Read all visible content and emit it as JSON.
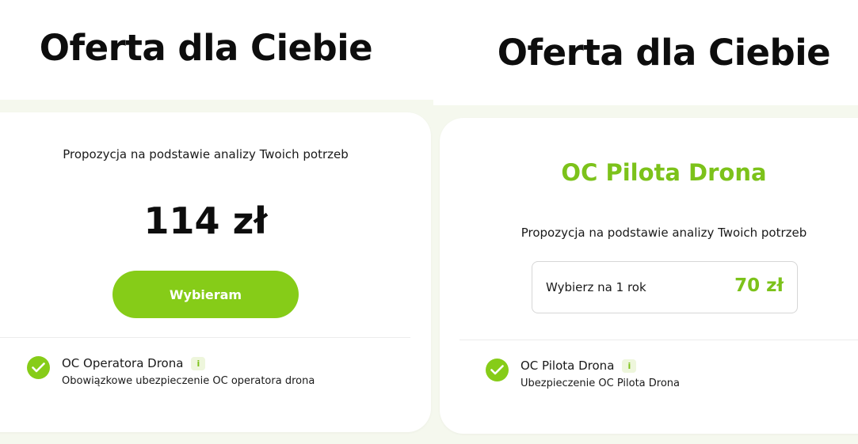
{
  "left": {
    "heading": "Oferta dla Ciebie",
    "proposal": "Propozycja na podstawie analizy Twoich potrzeb",
    "price": "114 zł",
    "choose_button": "Wybieram",
    "feature": {
      "title": "OC Operatora Drona",
      "info": "i",
      "description": "Obowiązkowe ubezpieczenie OC operatora drona"
    }
  },
  "right": {
    "heading": "Oferta dla Ciebie",
    "product_name": "OC Pilota Drona",
    "proposal": "Propozycja na podstawie analizy Twoich potrzeb",
    "option": {
      "label": "Wybierz na 1 rok",
      "price": "70 zł"
    },
    "feature": {
      "title": "OC Pilota Drona",
      "info": "i",
      "description": "Ubezpieczenie OC Pilota Drona"
    }
  },
  "colors": {
    "accent": "#86cc18",
    "accent_text": "#7cc21a",
    "background_tint": "#f5f8ee"
  }
}
